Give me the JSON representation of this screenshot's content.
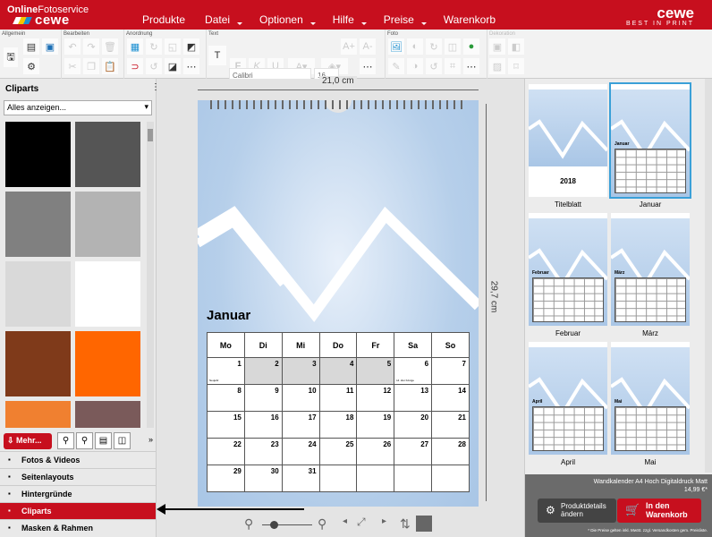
{
  "header": {
    "logo_online": "Online",
    "logo_foto": "Fotoservice",
    "logo_cewe": "cewe",
    "brand": "cewe",
    "brand_tag": "BEST IN PRINT",
    "menu": [
      "Produkte",
      "Datei",
      "Optionen",
      "Hilfe",
      "Preise",
      "Warenkorb"
    ]
  },
  "toolbar": {
    "groups": [
      "Allgemein",
      "Bearbeiten",
      "Anordnung",
      "Text",
      "Foto",
      "Dekoration"
    ],
    "font": "Calibri",
    "size": "16"
  },
  "left": {
    "title": "Cliparts",
    "filter": "Alles anzeigen...",
    "more": "Mehr...",
    "swatches": [
      "#000000",
      "#555555",
      "#808080",
      "#b3b3b3",
      "#d9d9d9",
      "#ffffff",
      "#7f3a1a",
      "#ff6600",
      "#f08030",
      "#7a5a5a"
    ],
    "nav": [
      {
        "label": "Fotos & Videos",
        "icon": "photo-icon"
      },
      {
        "label": "Seitenlayouts",
        "icon": "layout-icon"
      },
      {
        "label": "Hintergründe",
        "icon": "background-icon"
      },
      {
        "label": "Cliparts",
        "icon": "clipart-icon",
        "active": true
      },
      {
        "label": "Masken & Rahmen",
        "icon": "mask-icon"
      }
    ]
  },
  "canvas": {
    "width": "21,0 cm",
    "height": "29,7 cm",
    "month": "Januar",
    "weekdays": [
      "Mo",
      "Di",
      "Mi",
      "Do",
      "Fr",
      "Sa",
      "So"
    ],
    "weeks": [
      [
        "1",
        "2",
        "3",
        "4",
        "5",
        "6",
        "7"
      ],
      [
        "8",
        "9",
        "10",
        "11",
        "12",
        "13",
        "14"
      ],
      [
        "15",
        "16",
        "17",
        "18",
        "19",
        "20",
        "21"
      ],
      [
        "22",
        "23",
        "24",
        "25",
        "26",
        "27",
        "28"
      ],
      [
        "29",
        "30",
        "31",
        "",
        "",
        "",
        ""
      ]
    ],
    "holidays": {
      "1": "Neujahr",
      "6": "Hl. drei Könige"
    },
    "gray": [
      "2",
      "3",
      "4",
      "5"
    ]
  },
  "pages": [
    {
      "label": "Titelblatt",
      "year": "2018"
    },
    {
      "label": "Januar",
      "active": true
    },
    {
      "label": "Februar"
    },
    {
      "label": "März"
    },
    {
      "label": "April"
    },
    {
      "label": "Mai"
    }
  ],
  "product": {
    "name": "Wandkalender A4 Hoch Digitaldruck Matt",
    "price": "14,99 €*",
    "details": "Produktdetails ändern",
    "cart": "In den Warenkorb",
    "note": "* Die Preise gelten inkl. MwSt. zzgl. Versandkosten gem. Preisliste."
  },
  "colors": {
    "brand": "#c70f1e",
    "selection": "#3aa0d8"
  }
}
